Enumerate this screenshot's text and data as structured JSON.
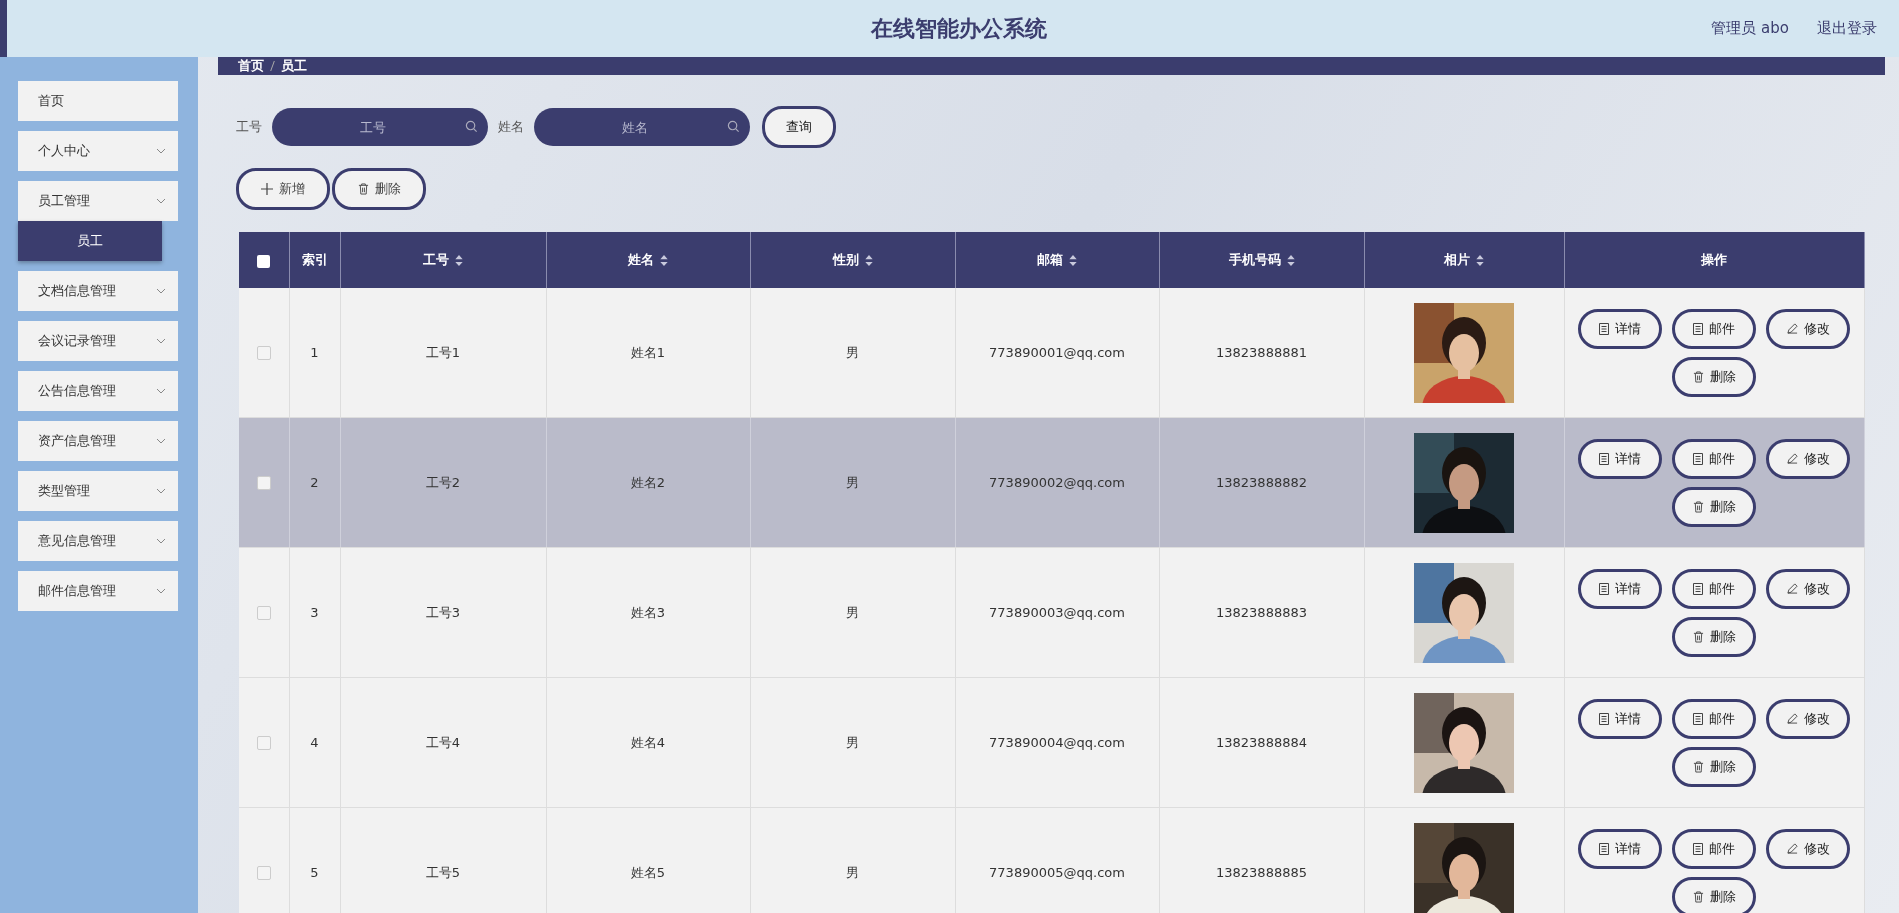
{
  "header": {
    "title": "在线智能办公系统",
    "user": "管理员 abo",
    "logout": "退出登录"
  },
  "sidebar": {
    "items": [
      {
        "label": "首页",
        "expandable": false
      },
      {
        "label": "个人中心",
        "expandable": true
      },
      {
        "label": "员工管理",
        "expandable": true,
        "children": [
          {
            "label": "员工",
            "selected": true
          }
        ]
      },
      {
        "label": "文档信息管理",
        "expandable": true
      },
      {
        "label": "会议记录管理",
        "expandable": true
      },
      {
        "label": "公告信息管理",
        "expandable": true
      },
      {
        "label": "资产信息管理",
        "expandable": true
      },
      {
        "label": "类型管理",
        "expandable": true
      },
      {
        "label": "意见信息管理",
        "expandable": true
      },
      {
        "label": "邮件信息管理",
        "expandable": true
      }
    ]
  },
  "breadcrumb": [
    "首页",
    "员工"
  ],
  "search": {
    "fields": [
      {
        "label": "工号",
        "placeholder": "工号"
      },
      {
        "label": "姓名",
        "placeholder": "姓名"
      }
    ],
    "button": "查询"
  },
  "actions": [
    {
      "kind": "add",
      "label": "新增"
    },
    {
      "kind": "delete",
      "label": "删除"
    }
  ],
  "table": {
    "select_all": {
      "checked": false
    },
    "columns": [
      {
        "label": "索引",
        "sortable": false
      },
      {
        "label": "工号",
        "sortable": true
      },
      {
        "label": "姓名",
        "sortable": true
      },
      {
        "label": "性别",
        "sortable": true
      },
      {
        "label": "邮箱",
        "sortable": true
      },
      {
        "label": "手机号码",
        "sortable": true
      },
      {
        "label": "相片",
        "sortable": true
      },
      {
        "label": "操作",
        "sortable": false
      }
    ],
    "rows": [
      {
        "index": "1",
        "id": "工号1",
        "name": "姓名1",
        "gender": "男",
        "email": "773890001@qq.com",
        "phone": "13823888881",
        "checked": false,
        "selected": false,
        "actions": [
          {
            "kind": "doc",
            "label": "详情"
          },
          {
            "kind": "doc",
            "label": "邮件"
          },
          {
            "kind": "edit",
            "label": "修改"
          },
          {
            "kind": "delete",
            "label": "删除"
          }
        ]
      },
      {
        "index": "2",
        "id": "工号2",
        "name": "姓名2",
        "gender": "男",
        "email": "773890002@qq.com",
        "phone": "13823888882",
        "checked": false,
        "selected": true,
        "actions": [
          {
            "kind": "doc",
            "label": "详情"
          },
          {
            "kind": "doc",
            "label": "邮件"
          },
          {
            "kind": "edit",
            "label": "修改"
          },
          {
            "kind": "delete",
            "label": "删除"
          }
        ]
      },
      {
        "index": "3",
        "id": "工号3",
        "name": "姓名3",
        "gender": "男",
        "email": "773890003@qq.com",
        "phone": "13823888883",
        "checked": false,
        "selected": false,
        "actions": [
          {
            "kind": "doc",
            "label": "详情"
          },
          {
            "kind": "doc",
            "label": "邮件"
          },
          {
            "kind": "edit",
            "label": "修改"
          },
          {
            "kind": "delete",
            "label": "删除"
          }
        ]
      },
      {
        "index": "4",
        "id": "工号4",
        "name": "姓名4",
        "gender": "男",
        "email": "773890004@qq.com",
        "phone": "13823888884",
        "checked": false,
        "selected": false,
        "actions": [
          {
            "kind": "doc",
            "label": "详情"
          },
          {
            "kind": "doc",
            "label": "邮件"
          },
          {
            "kind": "edit",
            "label": "修改"
          },
          {
            "kind": "delete",
            "label": "删除"
          }
        ]
      },
      {
        "index": "5",
        "id": "工号5",
        "name": "姓名5",
        "gender": "男",
        "email": "773890005@qq.com",
        "phone": "13823888885",
        "checked": false,
        "selected": false,
        "actions": [
          {
            "kind": "doc",
            "label": "详情"
          },
          {
            "kind": "doc",
            "label": "邮件"
          },
          {
            "kind": "edit",
            "label": "修改"
          },
          {
            "kind": "delete",
            "label": "删除"
          }
        ]
      }
    ]
  }
}
